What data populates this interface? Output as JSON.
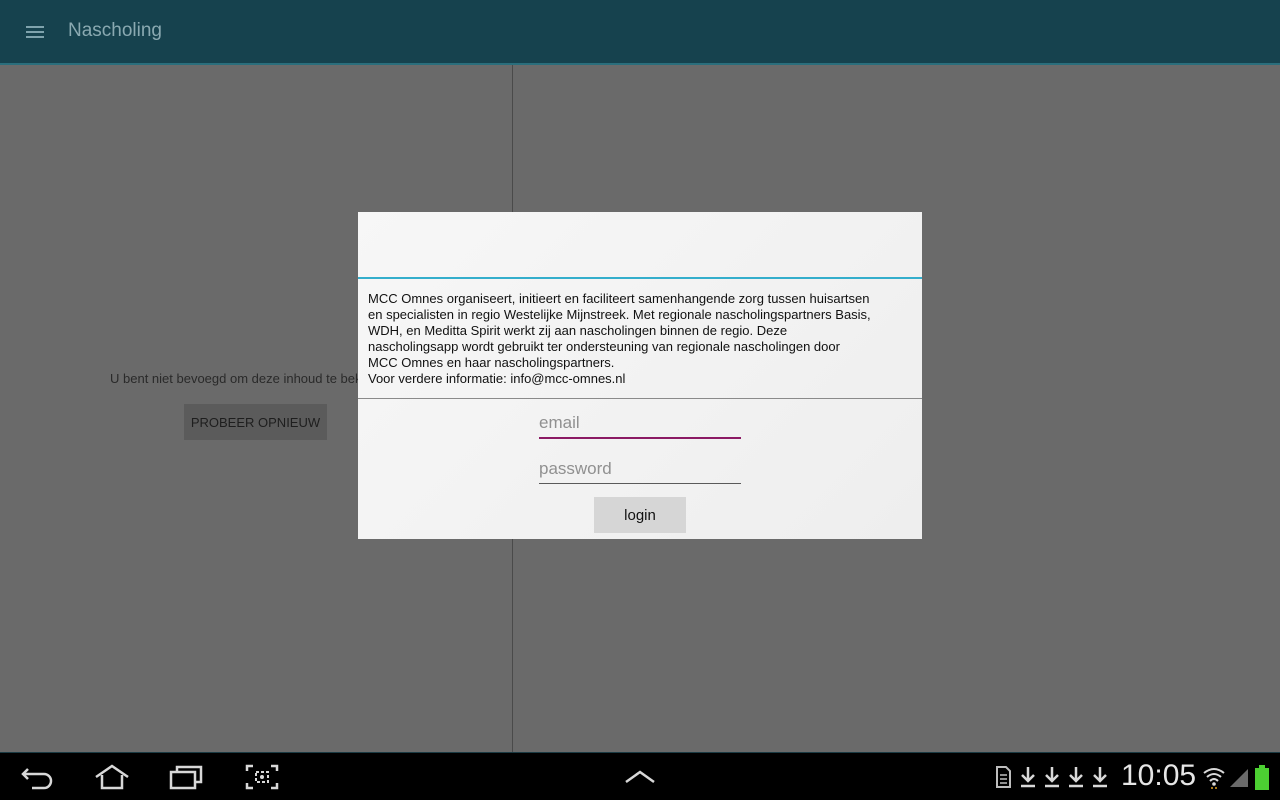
{
  "app": {
    "title": "Nascholing",
    "menu_icon": "hamburger-menu-icon"
  },
  "content": {
    "message": "U bent niet bevoegd om deze inhoud te bekijken",
    "retry_label": "PROBEER OPNIEUW"
  },
  "dialog": {
    "title": "",
    "body_lines": [
      "MCC Omnes organiseert, initieert en faciliteert samenhangende zorg tussen huisartsen",
      "en specialisten in regio Westelijke Mijnstreek. Met regionale nascholingspartners Basis,",
      "WDH, en Meditta Spirit werkt zij aan nascholingen binnen de regio. Deze",
      "nascholingsapp wordt gebruikt ter ondersteuning van regionale nascholingen door",
      "MCC Omnes en haar nascholingspartners.",
      "Voor verdere informatie: info@mcc-omnes.nl"
    ],
    "email": {
      "value": "",
      "placeholder": "email"
    },
    "password": {
      "value": "",
      "placeholder": "password"
    },
    "login_label": "login",
    "title_underline_color": "#34aecc",
    "focus_color": "#8b1a64"
  },
  "system_bar": {
    "time": "10:05",
    "nav_icons": [
      "back-icon",
      "home-icon",
      "recent-apps-icon",
      "screenshot-icon",
      "chevron-up-icon"
    ],
    "status_icons": [
      "sd-card-icon",
      "download-icon",
      "download-icon",
      "download-icon",
      "download-icon",
      "wifi-icon",
      "signal-icon",
      "battery-icon"
    ],
    "battery_color": "#4cd032"
  }
}
